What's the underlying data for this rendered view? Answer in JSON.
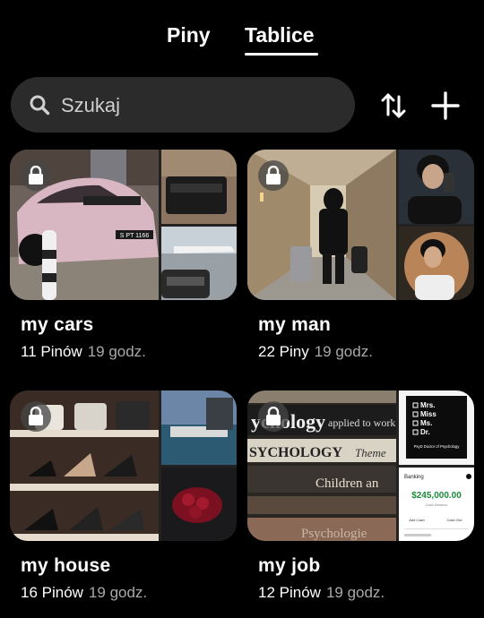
{
  "tabs": [
    {
      "label": "Piny",
      "active": false
    },
    {
      "label": "Tablice",
      "active": true
    }
  ],
  "search": {
    "placeholder": "Szukaj",
    "icon": "search-icon"
  },
  "toolbar": {
    "sort_icon": "sort-arrows-icon",
    "add_icon": "plus-icon"
  },
  "boards": [
    {
      "title": "my cars",
      "count": "11 Pinów",
      "time": "19 godz.",
      "private": true
    },
    {
      "title": "my man",
      "count": "22 Piny",
      "time": "19 godz.",
      "private": true
    },
    {
      "title": "my house",
      "count": "16 Pinów",
      "time": "19 godz.",
      "private": true
    },
    {
      "title": "my job",
      "count": "12 Pinów",
      "time": "19 godz.",
      "private": true
    }
  ],
  "cover_text": {
    "plate": "S PT 1166",
    "psych_word1": "ychology",
    "psych_word2": "applied to work",
    "psych_word3": "SYCHOLOGY",
    "psych_word4": "Theme",
    "psych_word5": "Children an",
    "psych_word6": "Psychologie",
    "mrs_list": [
      "Mrs.",
      "Miss",
      "Ms.",
      "Dr."
    ],
    "phd": "PsyD Doctor of Psychology",
    "bank_title": "Banking",
    "bank_amount": "$245,000.00",
    "bank_sub": "Cash Balance",
    "bank_btn1": "Add Cash",
    "bank_btn2": "Cash Out"
  },
  "colors": {
    "background": "#000000",
    "search_bg": "#2b2b2b",
    "meta_time": "#a9a9a9"
  }
}
